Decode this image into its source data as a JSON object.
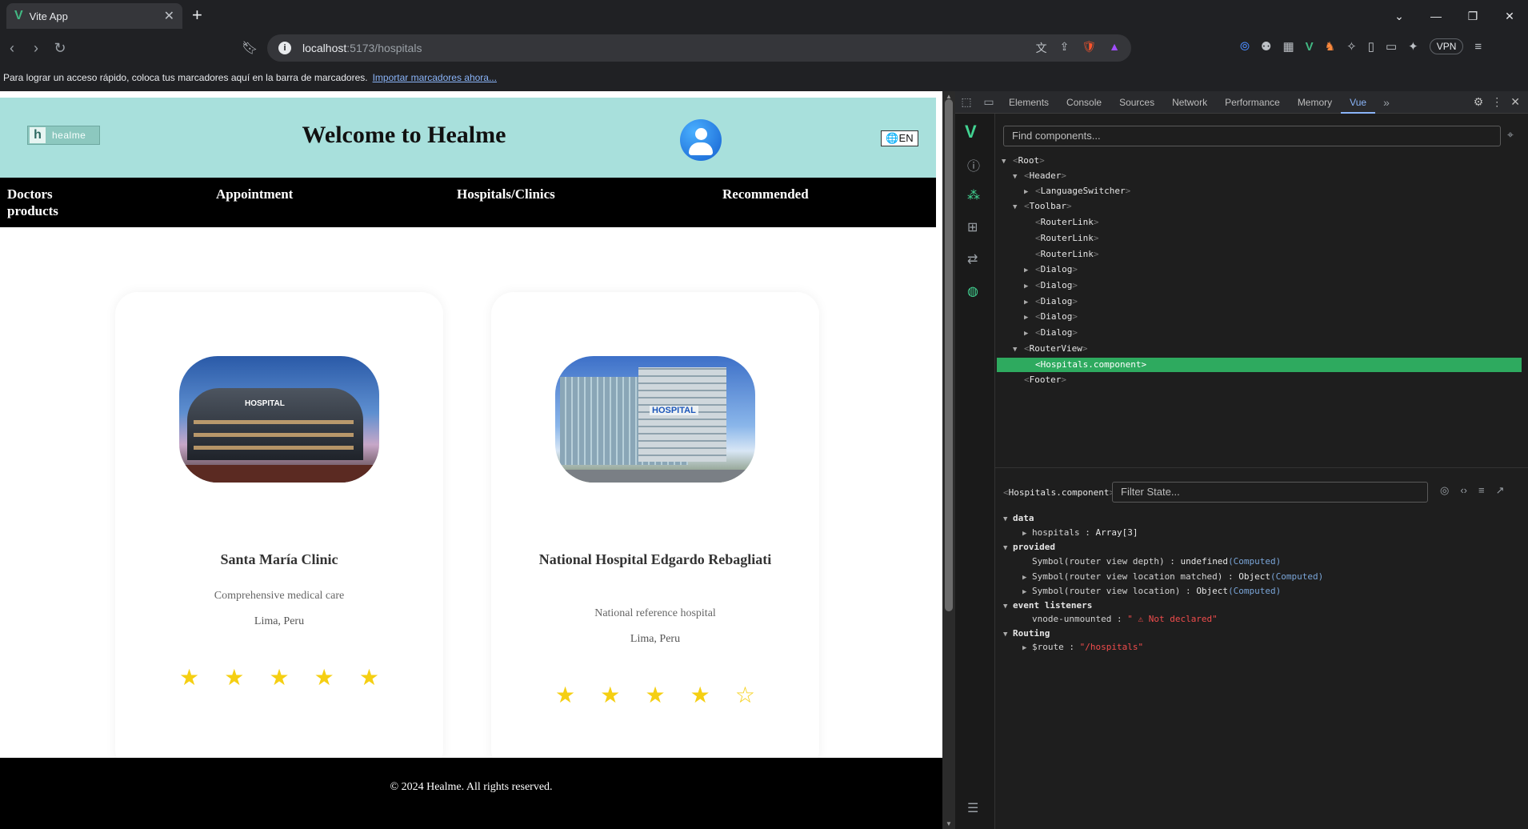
{
  "browser": {
    "tab_title": "Vite App",
    "url_host": "localhost",
    "url_path": ":5173/hospitals",
    "vpn_label": "VPN",
    "bookmark_bar_text": "Para lograr un acceso rápido, coloca tus marcadores aquí en la barra de marcadores.",
    "bookmark_bar_link": "Importar marcadores ahora..."
  },
  "site": {
    "logo_text": "healme",
    "title": "Welcome to Healme",
    "lang_button": "🌐EN",
    "nav": {
      "doctors": "Doctors",
      "products": "products",
      "appointment": "Appointment",
      "hospitals": "Hospitals/Clinics",
      "recommended": "Recommended"
    },
    "hospitals": [
      {
        "name": "Santa María Clinic",
        "description": "Comprehensive medical care",
        "location": "Lima, Peru",
        "rating": 5,
        "sign": "HOSPITAL"
      },
      {
        "name": "National Hospital Edgardo Rebagliati",
        "description": "National reference hospital",
        "location": "Lima, Peru",
        "rating": 4,
        "sign": "HOSPITAL"
      }
    ],
    "footer": "© 2024 Healme. All rights reserved."
  },
  "devtools": {
    "tabs": [
      "Elements",
      "Console",
      "Sources",
      "Network",
      "Performance",
      "Memory",
      "Vue"
    ],
    "active_tab": "Vue",
    "find_placeholder": "Find components...",
    "tree": {
      "root": "Root",
      "header": "Header",
      "language_switcher": "LanguageSwitcher",
      "toolbar": "Toolbar",
      "router_link": "RouterLink",
      "dialog": "Dialog",
      "router_view": "RouterView",
      "selected": "Hospitals.component",
      "footer": "Footer"
    },
    "state": {
      "component_label": "Hospitals.component",
      "filter_placeholder": "Filter State...",
      "data_label": "data",
      "hospitals_key": "hospitals",
      "hospitals_val": "Array[3]",
      "provided_label": "provided",
      "p1_key": "Symbol(router view depth)",
      "p1_val": "undefined",
      "p2_key": "Symbol(router view location matched)",
      "p2_val": "Object",
      "p3_key": "Symbol(router view location)",
      "p3_val": "Object",
      "computed_tag": "(Computed)",
      "events_label": "event listeners",
      "ev_key": "vnode-unmounted",
      "ev_val": "\" ⚠ Not declared\"",
      "routing_label": "Routing",
      "route_key": "$route",
      "route_val": "\"/hospitals\""
    }
  }
}
